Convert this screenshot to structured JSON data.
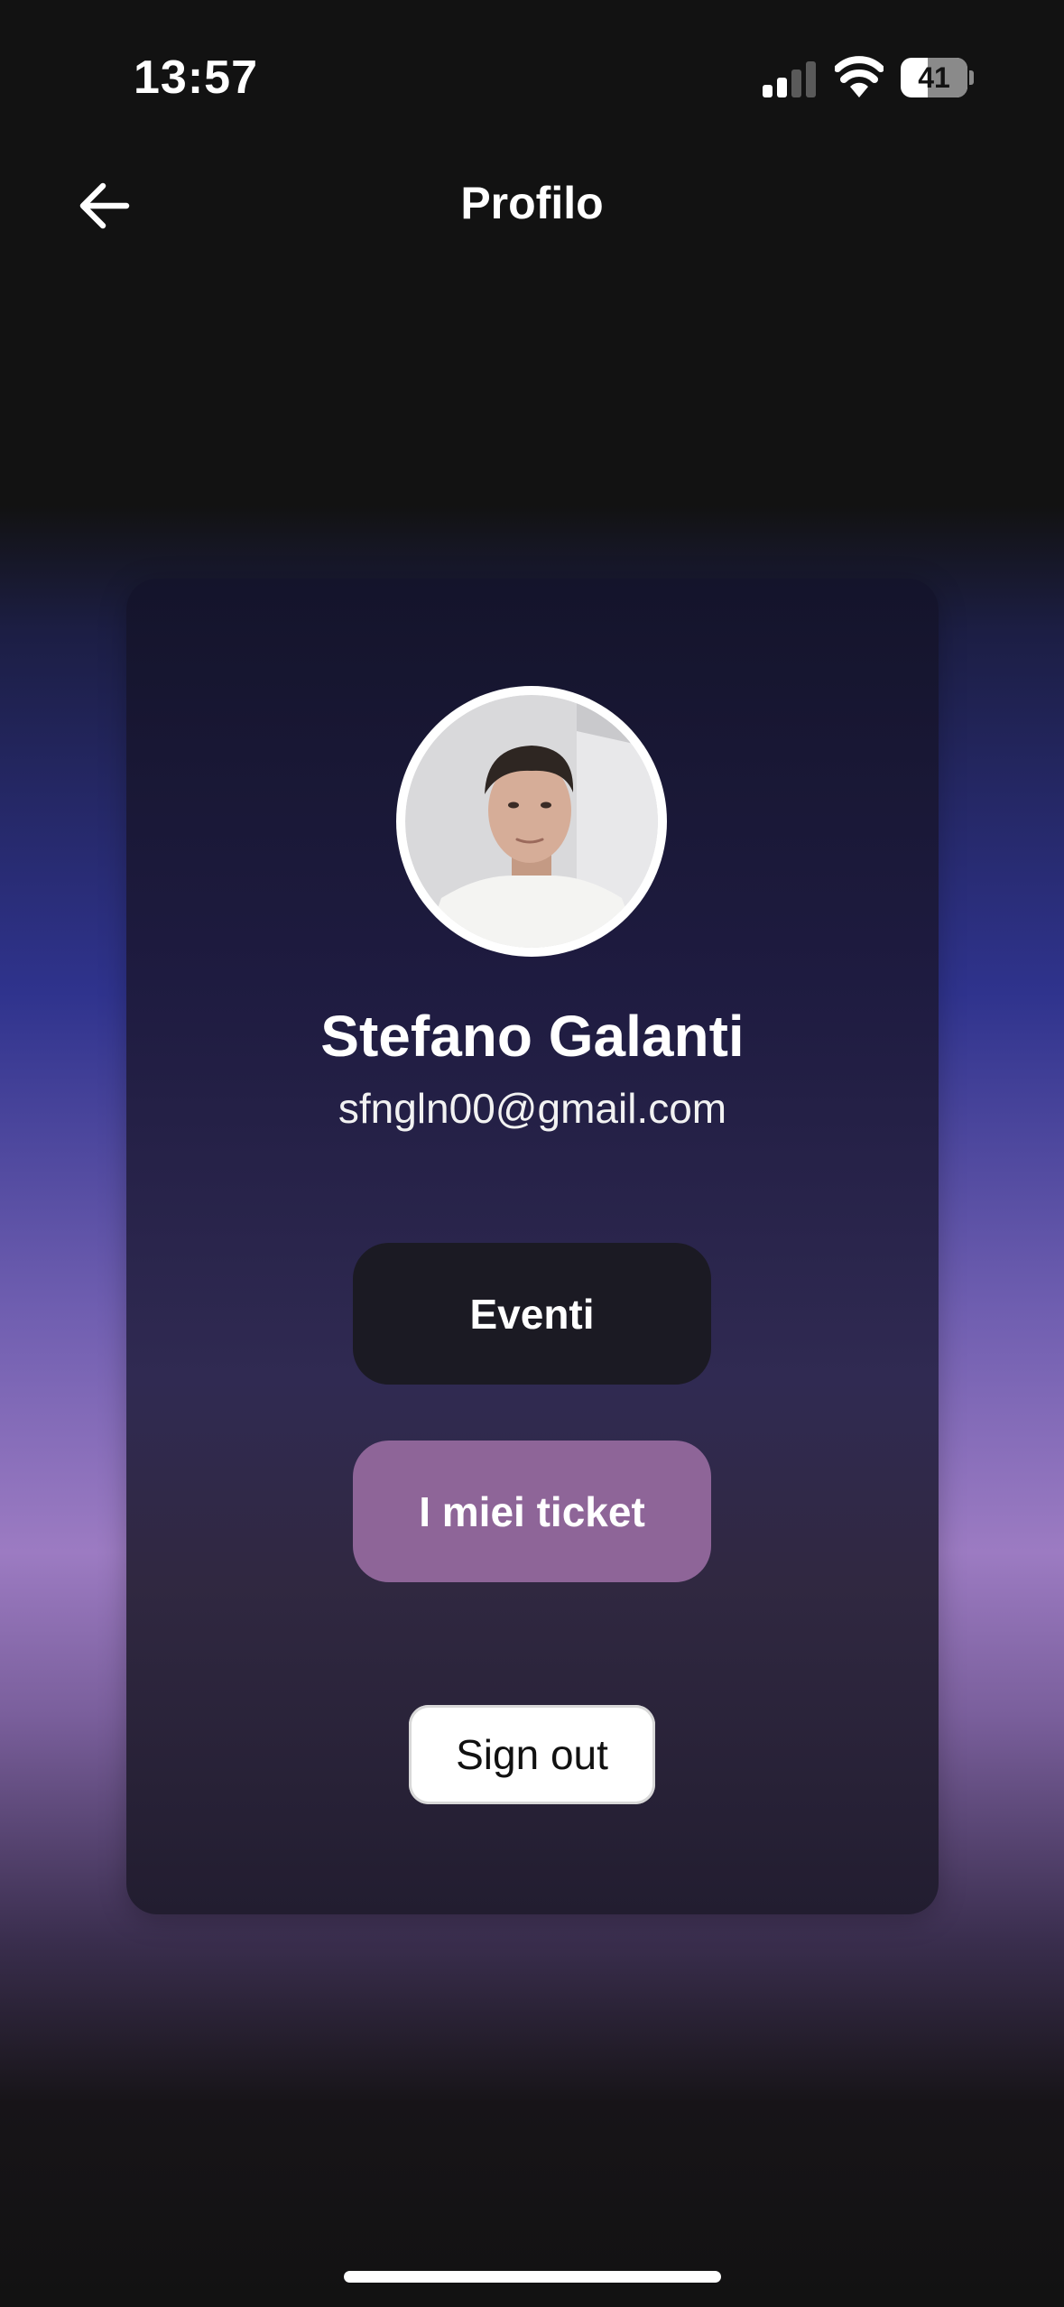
{
  "status_bar": {
    "time": "13:57",
    "battery_level": "41",
    "battery_fraction": 0.41,
    "icons": [
      "signal-icon",
      "wifi-icon",
      "battery-icon"
    ]
  },
  "nav": {
    "title": "Profilo",
    "back_icon": "arrow-left-icon"
  },
  "profile": {
    "name": "Stefano Galanti",
    "email": "sfngln00@gmail.com",
    "avatar_icon": "user-photo"
  },
  "actions": {
    "eventi_label": "Eventi",
    "tickets_label": "I miei ticket",
    "signout_label": "Sign out"
  },
  "colors": {
    "background": "#121212",
    "accent_purple": "#8e6598",
    "button_dark": "#1b1a23",
    "gradient_blue": "#2f338d",
    "gradient_lilac": "#9c7bc2"
  }
}
